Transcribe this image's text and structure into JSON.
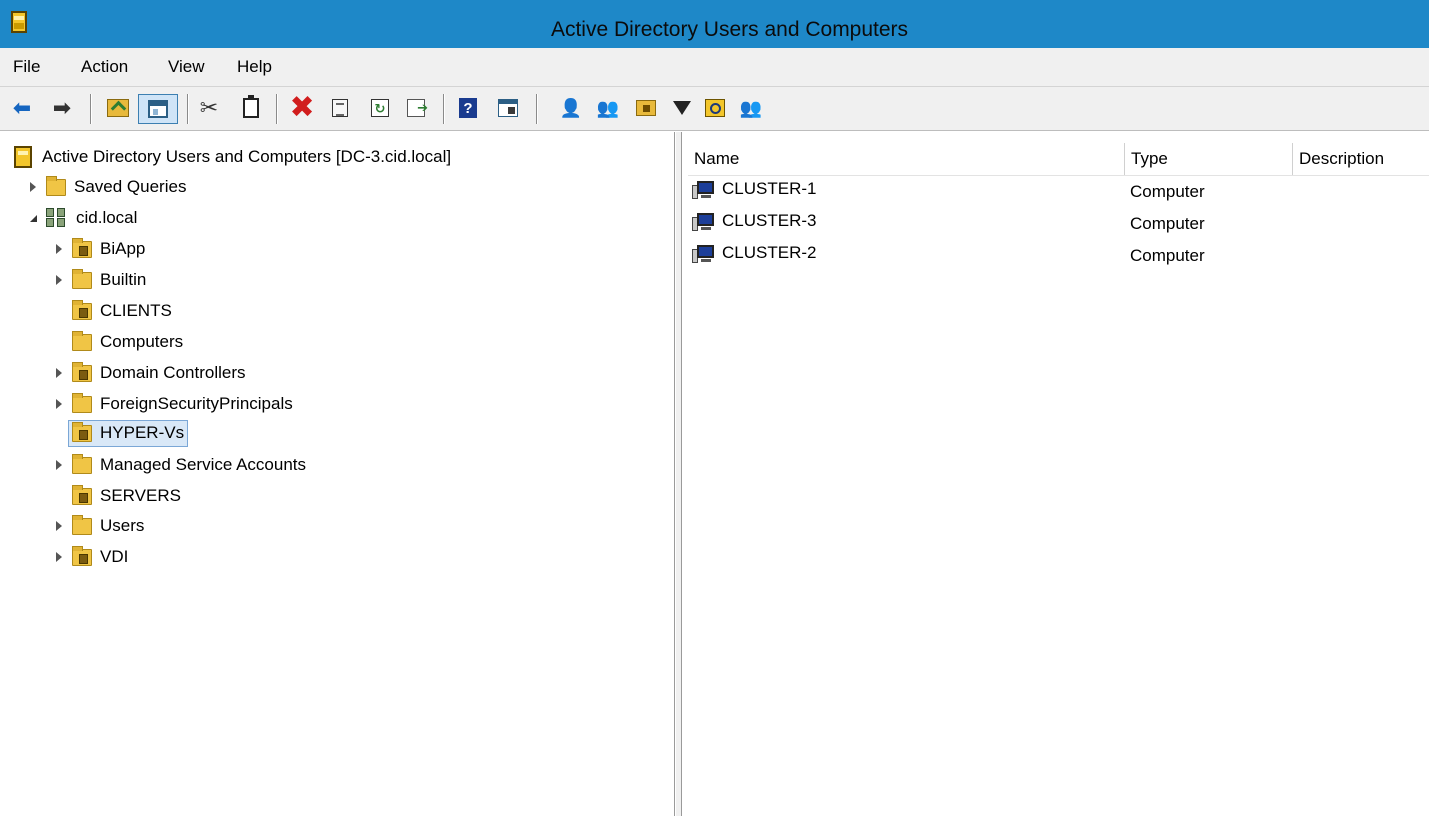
{
  "window": {
    "title": "Active Directory Users and Computers"
  },
  "menu": {
    "items": [
      "File",
      "Action",
      "View",
      "Help"
    ]
  },
  "toolbar": {
    "buttons": [
      "back-icon",
      "forward-icon",
      "up-one-level-icon",
      "show-hide-console-tree-icon",
      "cut-icon",
      "copy-icon",
      "delete-icon",
      "properties-icon",
      "refresh-icon",
      "export-list-icon",
      "help-icon",
      "show-hide-action-pane-icon",
      "create-user-icon",
      "create-group-icon",
      "create-ou-icon",
      "filter-icon",
      "find-objects-icon",
      "add-to-group-icon"
    ]
  },
  "tree": {
    "root": "Active Directory Users and Computers [DC-3.cid.local]",
    "saved_queries": "Saved Queries",
    "domain": "cid.local",
    "children": [
      {
        "label": "BiApp",
        "expandable": true,
        "kind": "ou"
      },
      {
        "label": "Builtin",
        "expandable": true,
        "kind": "container"
      },
      {
        "label": "CLIENTS",
        "expandable": false,
        "kind": "ou"
      },
      {
        "label": "Computers",
        "expandable": false,
        "kind": "container"
      },
      {
        "label": "Domain Controllers",
        "expandable": true,
        "kind": "ou"
      },
      {
        "label": "ForeignSecurityPrincipals",
        "expandable": true,
        "kind": "container"
      },
      {
        "label": "HYPER-Vs",
        "expandable": false,
        "kind": "ou",
        "selected": true
      },
      {
        "label": "Managed Service Accounts",
        "expandable": true,
        "kind": "container"
      },
      {
        "label": "SERVERS",
        "expandable": false,
        "kind": "ou"
      },
      {
        "label": "Users",
        "expandable": true,
        "kind": "container"
      },
      {
        "label": "VDI",
        "expandable": true,
        "kind": "ou"
      }
    ]
  },
  "list": {
    "columns": [
      "Name",
      "Type",
      "Description"
    ],
    "rows": [
      {
        "name": "CLUSTER-1",
        "type": "Computer",
        "description": ""
      },
      {
        "name": "CLUSTER-3",
        "type": "Computer",
        "description": ""
      },
      {
        "name": "CLUSTER-2",
        "type": "Computer",
        "description": ""
      }
    ]
  },
  "colors": {
    "titlebar": "#1e88c8",
    "chrome": "#f0f0f0",
    "selection": "#d9e8f7",
    "selection_border": "#7ba7d6"
  }
}
